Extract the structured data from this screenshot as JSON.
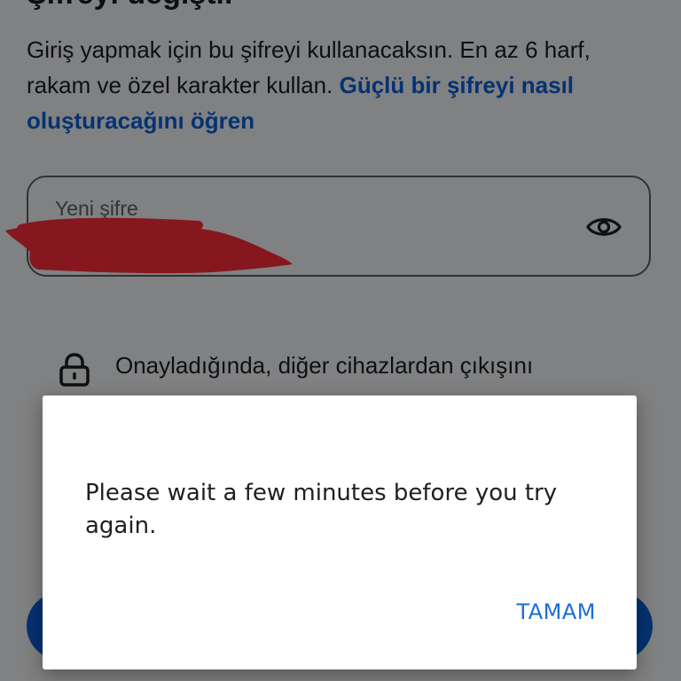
{
  "screen": {
    "title": "Şifreyi değiştir",
    "description": "Giriş yapmak için bu şifreyi kullanacaksın. En az 6 harf, rakam ve özel karakter kullan.",
    "description_link": "Güçlü bir şifreyi nasıl oluşturacağını öğren",
    "password_field": {
      "label": "Yeni şifre",
      "value": "••••••••••",
      "icon": "eye-icon"
    },
    "info_text": "Onayladığında, diğer cihazlardan çıkışını",
    "info_icon": "lock-icon",
    "colors": {
      "link": "#0a5fd6",
      "redaction": "#ff2d3a"
    }
  },
  "dialog": {
    "message": "Please wait a few minutes before you try again.",
    "ok_label": "TAMAM",
    "button_color": "#1b6ed6"
  }
}
